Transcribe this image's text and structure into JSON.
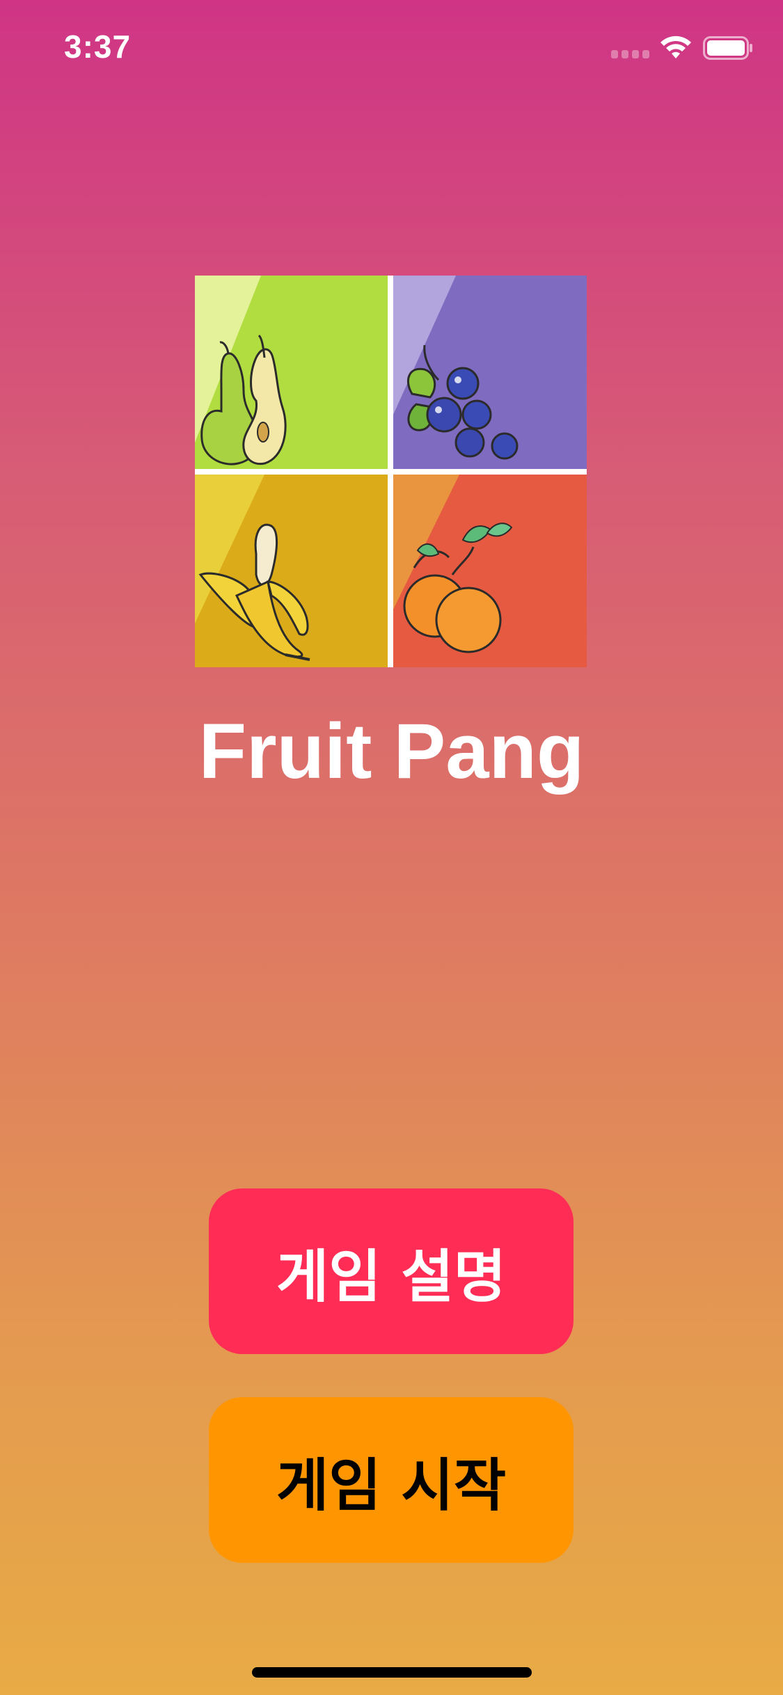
{
  "status_bar": {
    "time": "3:37",
    "icons": [
      "cellular-signal-icon",
      "wifi-icon",
      "battery-icon"
    ]
  },
  "logo": {
    "icon_name": "fruit-grid-logo",
    "tiles": [
      {
        "fruit": "pear-icon",
        "color": "#b1dd40"
      },
      {
        "fruit": "blueberry-icon",
        "color": "#7f6bbf"
      },
      {
        "fruit": "banana-icon",
        "color": "#dcab1a"
      },
      {
        "fruit": "orange-icon",
        "color": "#e55a40"
      }
    ]
  },
  "title": "Fruit Pang",
  "buttons": {
    "help_label": "게임 설명",
    "start_label": "게임 시작"
  },
  "colors": {
    "background_top": "#cf3485",
    "background_bottom": "#e8ab45",
    "help_button": "#ff2d55",
    "start_button": "#ff9500"
  }
}
